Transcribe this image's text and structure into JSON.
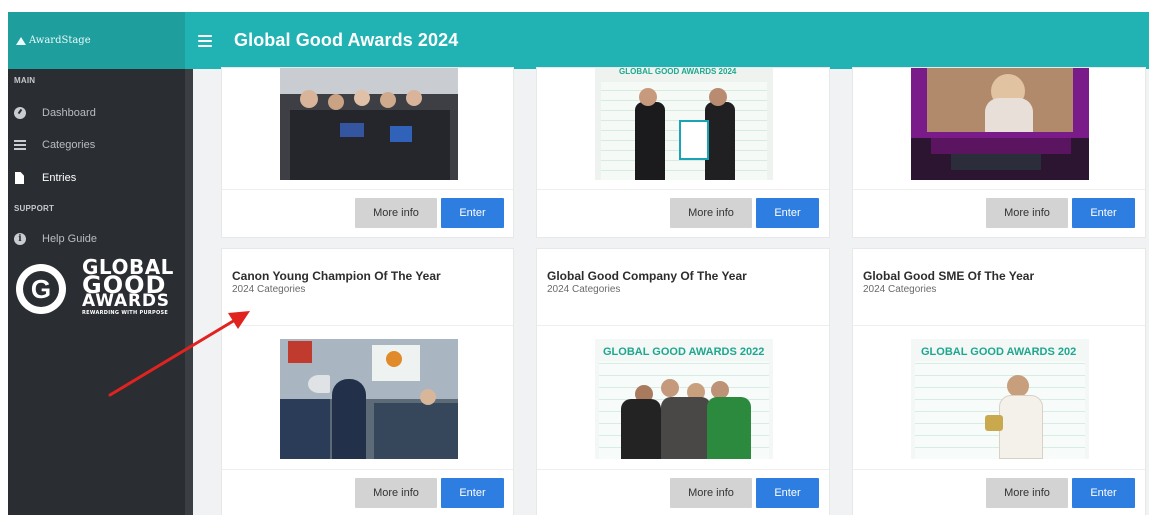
{
  "brand": {
    "name": "AwardStage",
    "icon": "mountain-icon"
  },
  "header": {
    "title": "Global Good Awards 2024",
    "menu_icon": "hamburger-icon"
  },
  "sidebar": {
    "section_main": "MAIN",
    "section_support": "SUPPORT",
    "items": [
      {
        "label": "Dashboard",
        "icon": "dashboard-icon",
        "active": false
      },
      {
        "label": "Categories",
        "icon": "list-icon",
        "active": false
      },
      {
        "label": "Entries",
        "icon": "file-icon",
        "active": true
      },
      {
        "label": "Help Guide",
        "icon": "info-icon",
        "active": false
      }
    ],
    "logo": {
      "line1": "GLOBAL",
      "line2": "GOOD",
      "line3": "AWARDS",
      "tagline": "REWARDING WITH PURPOSE"
    }
  },
  "buttons": {
    "more_info": "More info",
    "enter": "Enter"
  },
  "cards_row2": [
    {
      "title": "Canon Young Champion Of The Year",
      "subtitle": "2024 Categories"
    },
    {
      "title": "Global Good Company Of The Year",
      "subtitle": "2024 Categories"
    },
    {
      "title": "Global Good SME Of The Year",
      "subtitle": "2024 Categories"
    }
  ],
  "photo_banners": {
    "card1_top": "GLOBAL GOOD AWARDS 2024",
    "card2": "GLOBAL GOOD AWARDS 2022",
    "card3": "GLOBAL GOOD AWARDS 202"
  },
  "colors": {
    "header_teal": "#21b3b3",
    "sidebar": "#2a2d32",
    "enter_blue": "#2e7de0",
    "annotation_arrow": "#e0231f"
  }
}
